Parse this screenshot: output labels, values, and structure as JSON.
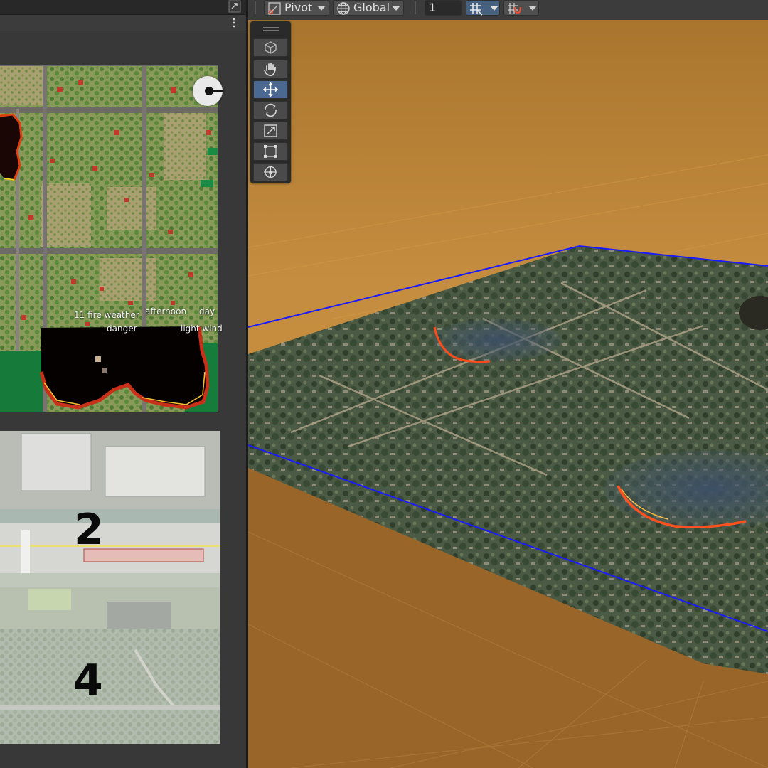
{
  "toolbar": {
    "pivot_label": "Pivot",
    "global_label": "Global",
    "grid_size_value": "1"
  },
  "map_preview": {
    "overlay_lines": [
      "11 fire weather",
      "afternoon",
      "day",
      "danger",
      "light wind"
    ]
  },
  "thumbnails": [
    {
      "number": "2"
    },
    {
      "number": "4"
    }
  ],
  "tools": [
    {
      "name": "view-tool"
    },
    {
      "name": "hand-tool"
    },
    {
      "name": "move-tool",
      "active": true
    },
    {
      "name": "rotate-tool"
    },
    {
      "name": "scale-tool"
    },
    {
      "name": "rect-tool"
    },
    {
      "name": "transform-tool"
    }
  ],
  "colors": {
    "sky": "#c48a3a",
    "ground": "#9a6629",
    "selection_outline": "#1a1aff",
    "active_tool": "#4b6891"
  }
}
